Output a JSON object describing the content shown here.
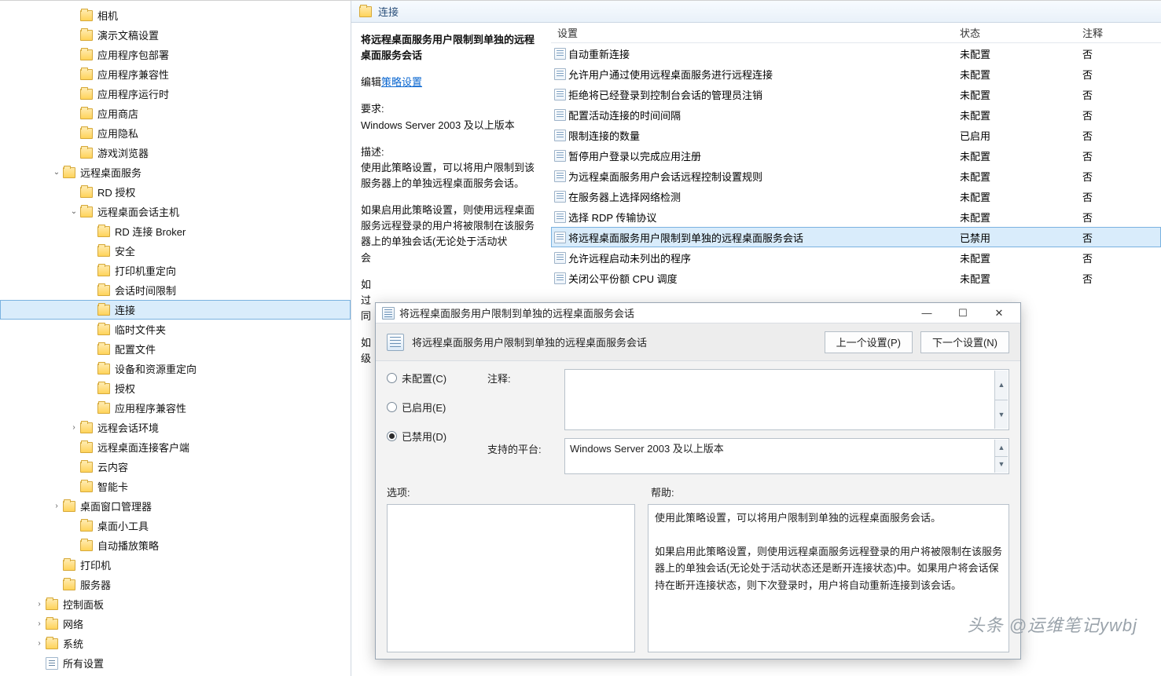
{
  "tree": [
    {
      "indent": 4,
      "label": "相机"
    },
    {
      "indent": 4,
      "label": "演示文稿设置"
    },
    {
      "indent": 4,
      "label": "应用程序包部署"
    },
    {
      "indent": 4,
      "label": "应用程序兼容性"
    },
    {
      "indent": 4,
      "label": "应用程序运行时"
    },
    {
      "indent": 4,
      "label": "应用商店"
    },
    {
      "indent": 4,
      "label": "应用隐私"
    },
    {
      "indent": 4,
      "label": "游戏浏览器"
    },
    {
      "indent": 3,
      "twisty": "open",
      "label": "远程桌面服务"
    },
    {
      "indent": 4,
      "label": "RD 授权"
    },
    {
      "indent": 4,
      "twisty": "open",
      "label": "远程桌面会话主机"
    },
    {
      "indent": 5,
      "label": "RD 连接 Broker"
    },
    {
      "indent": 5,
      "label": "安全"
    },
    {
      "indent": 5,
      "label": "打印机重定向"
    },
    {
      "indent": 5,
      "label": "会话时间限制"
    },
    {
      "indent": 5,
      "label": "连接",
      "selected": true
    },
    {
      "indent": 5,
      "label": "临时文件夹"
    },
    {
      "indent": 5,
      "label": "配置文件"
    },
    {
      "indent": 5,
      "label": "设备和资源重定向"
    },
    {
      "indent": 5,
      "label": "授权"
    },
    {
      "indent": 5,
      "label": "应用程序兼容性"
    },
    {
      "indent": 4,
      "twisty": "closed",
      "label": "远程会话环境"
    },
    {
      "indent": 4,
      "label": "远程桌面连接客户端"
    },
    {
      "indent": 4,
      "label": "云内容"
    },
    {
      "indent": 4,
      "label": "智能卡"
    },
    {
      "indent": 3,
      "twisty": "closed",
      "label": "桌面窗口管理器"
    },
    {
      "indent": 4,
      "label": "桌面小工具"
    },
    {
      "indent": 4,
      "label": "自动播放策略"
    },
    {
      "indent": 3,
      "label": "打印机"
    },
    {
      "indent": 3,
      "label": "服务器"
    },
    {
      "indent": 2,
      "twisty": "closed",
      "label": "控制面板"
    },
    {
      "indent": 2,
      "twisty": "closed",
      "label": "网络"
    },
    {
      "indent": 2,
      "twisty": "closed",
      "label": "系统"
    },
    {
      "indent": 2,
      "label": "所有设置",
      "doc": true
    }
  ],
  "panel": {
    "header_title": "连接",
    "desc_title": "将远程桌面服务用户限制到单独的远程桌面服务会话",
    "edit_label": "编辑",
    "link_policy": "策略设置",
    "req_label": "要求:",
    "req_value": "Windows Server 2003 及以上版本",
    "descr_label": "描述:",
    "descr_p1": "使用此策略设置，可以将用户限制到该服务器上的单独远程桌面服务会话。",
    "descr_p2_1": "如果启用此策略设置，则使用远程桌面服务远程登录的用户将被限制在该服务器上的单独会话(无论处于活动状",
    "descr_trunc2": "会",
    "descr_trunc3": "如",
    "descr_trunc4": "过",
    "descr_trunc5": "同",
    "descr_trunc6": "如",
    "descr_trunc7": "级"
  },
  "list": {
    "col_setting": "设置",
    "col_state": "状态",
    "col_note": "注释",
    "rows": [
      {
        "s": "自动重新连接",
        "st": "未配置",
        "n": "否"
      },
      {
        "s": "允许用户通过使用远程桌面服务进行远程连接",
        "st": "未配置",
        "n": "否"
      },
      {
        "s": "拒绝将已经登录到控制台会话的管理员注销",
        "st": "未配置",
        "n": "否"
      },
      {
        "s": "配置活动连接的时间间隔",
        "st": "未配置",
        "n": "否"
      },
      {
        "s": "限制连接的数量",
        "st": "已启用",
        "n": "否"
      },
      {
        "s": "暂停用户登录以完成应用注册",
        "st": "未配置",
        "n": "否"
      },
      {
        "s": "为远程桌面服务用户会话远程控制设置规则",
        "st": "未配置",
        "n": "否"
      },
      {
        "s": "在服务器上选择网络检测",
        "st": "未配置",
        "n": "否"
      },
      {
        "s": "选择 RDP 传输协议",
        "st": "未配置",
        "n": "否"
      },
      {
        "s": "将远程桌面服务用户限制到单独的远程桌面服务会话",
        "st": "已禁用",
        "n": "否",
        "sel": true
      },
      {
        "s": "允许远程启动未列出的程序",
        "st": "未配置",
        "n": "否"
      },
      {
        "s": "关闭公平份额 CPU 调度",
        "st": "未配置",
        "n": "否"
      }
    ]
  },
  "dialog": {
    "title": "将远程桌面服务用户限制到单独的远程桌面服务会话",
    "prev_btn": "上一个设置(P)",
    "next_btn": "下一个设置(N)",
    "radio_unconf": "未配置(C)",
    "radio_enable": "已启用(E)",
    "radio_disable": "已禁用(D)",
    "radio_selected": "disable",
    "lbl_note": "注释:",
    "lbl_support": "支持的平台:",
    "support_text": "Windows Server 2003 及以上版本",
    "lbl_options": "选项:",
    "lbl_help": "帮助:",
    "help_p1": "使用此策略设置，可以将用户限制到单独的远程桌面服务会话。",
    "help_p2": "如果启用此策略设置，则使用远程桌面服务远程登录的用户将被限制在该服务器上的单独会话(无论处于活动状态还是断开连接状态)中。如果用户将会话保持在断开连接状态，则下次登录时，用户将自动重新连接到该会话。"
  },
  "watermark": "头条 @运维笔记ywbj"
}
